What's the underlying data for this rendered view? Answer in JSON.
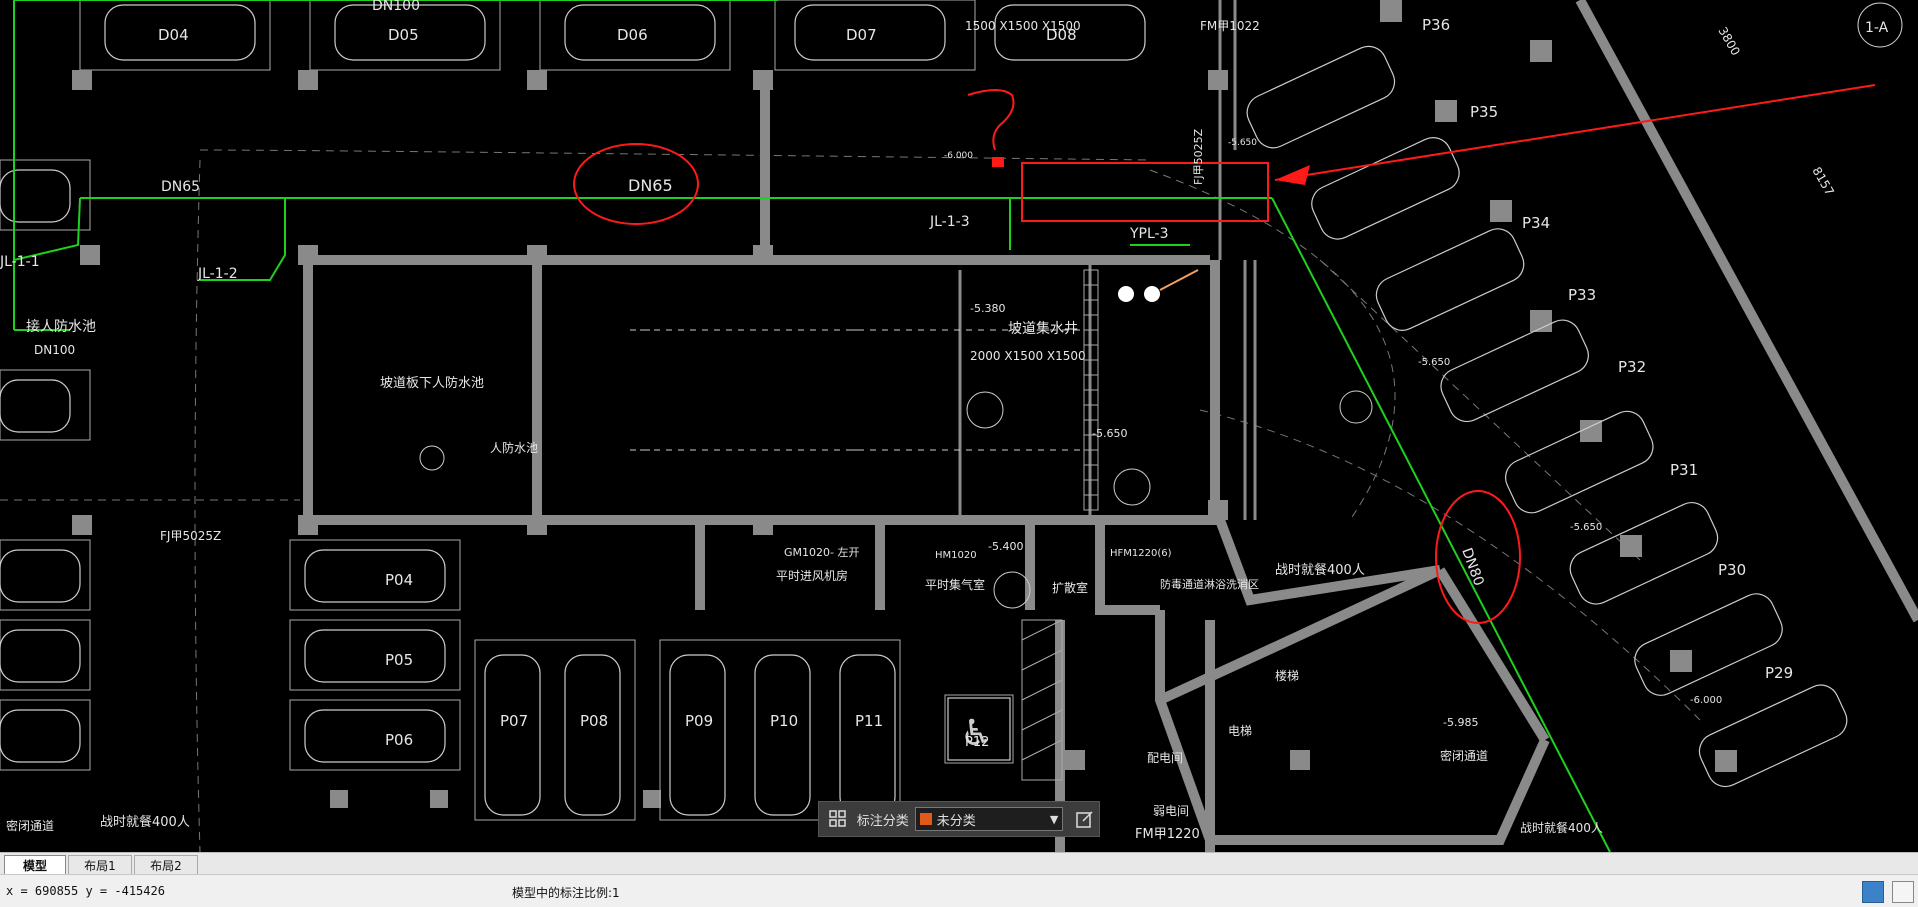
{
  "drawing": {
    "parking_labels": [
      "D04",
      "D05",
      "D06",
      "D07",
      "D08",
      "P04",
      "P05",
      "P06",
      "P07",
      "P08",
      "P09",
      "P10",
      "P11",
      "P29",
      "P30",
      "P31",
      "P32",
      "P33",
      "P34",
      "P35",
      "P36"
    ],
    "accessible_space": "P12",
    "pipe_labels": {
      "dn65_left": "DN65",
      "dn65_circled": "DN65",
      "dn80_circled": "DN80",
      "dn100_top": "DN100",
      "dn100_left": "DN100",
      "jl_1_1": "JL-1-1",
      "jl_1_2": "JL-1-2",
      "jl_1_3": "JL-1-3",
      "ypl_3": "YPL-3"
    },
    "room_labels": {
      "pool_room": "坡道板下人防水池",
      "sump": "坡道集水井",
      "sump_dims": "2000  X1500  X1500",
      "sump_top_dims": "1500  X1500  X1500",
      "fm_top": "FM甲1022",
      "fj_door": "FJ甲5025Z",
      "fj_bottom": "FJ甲5025Z",
      "ventilation": "平时进风机房",
      "gm_door": "GM1020-  左开",
      "exhaust": "平时集气室",
      "hm_door": "HM1020",
      "expansion": "扩散室",
      "hfm_door": "HFM1220(6)",
      "decon": "防毒通道淋浴洗消区",
      "shelter_400_right": "战时就餐400人",
      "shelter_400_left": "战时就餐400人",
      "shelter_400_bottom": "战时就餐400人",
      "stair": "楼梯",
      "elevator": "电梯",
      "secret_passage": "密闭通道",
      "secret_passage_left": "密闭通道",
      "distribution": "配电间",
      "weak_current": "弱电间",
      "fm_1220": "FM甲1220",
      "defense_tank": "人防水池",
      "access_left": "接人防水池",
      "elev_neg5_38": "-5.380",
      "elev_neg5_65_a": "-5.650",
      "elev_neg5_65_b": "-5.650",
      "elev_neg5_65_c": "-5.650",
      "elev_neg5_65_d": "-5.650",
      "elev_neg6": "-6.000",
      "elev_neg6_b": "-6.000",
      "elev_neg5_4": "-5.400",
      "elev_neg5_985": "-5.985",
      "dim_3800": "3800",
      "dim_8157": "8157",
      "grid_1a": "1-A",
      "question_mark": "?"
    }
  },
  "annotation_toolbar": {
    "label": "标注分类",
    "selected": "未分类",
    "swatch_color": "#e05a1a"
  },
  "tabs": [
    {
      "label": "模型",
      "active": true
    },
    {
      "label": "布局1",
      "active": false
    },
    {
      "label": "布局2",
      "active": false
    }
  ],
  "status": {
    "coords": "x = 690855  y = -415426",
    "scale": "模型中的标注比例:1"
  },
  "colors": {
    "pipe_green": "#1fd11f",
    "markup_red": "#ff1a1a",
    "wall_gray": "#8a8a8a",
    "canvas_bg": "#000000"
  }
}
